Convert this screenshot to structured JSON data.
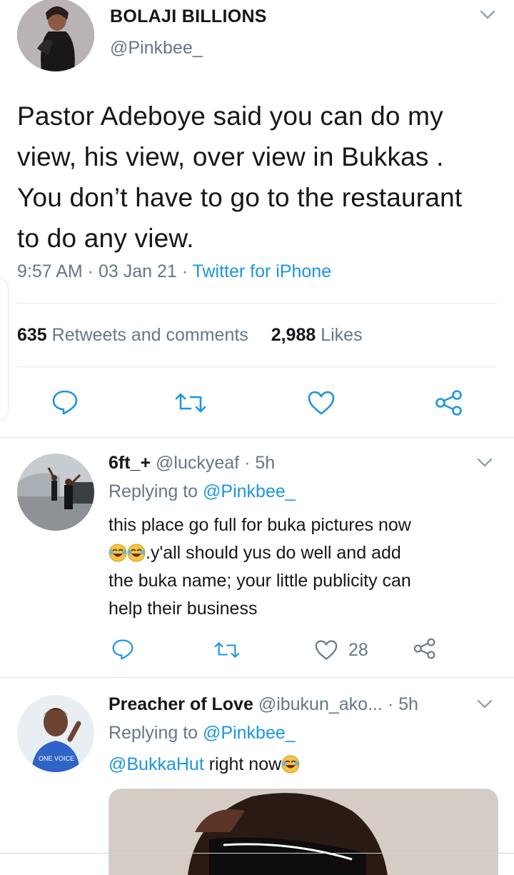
{
  "main_tweet": {
    "author_name": "BOLAJI BILLIONS",
    "author_handle": "@Pinkbee_",
    "text": "Pastor Adeboye said you can do my view, his view, over view in Bukkas . You don’t have to go to the restaurant to do any view.",
    "time": "9:57 AM",
    "date": "03 Jan 21",
    "sep": "·",
    "source": "Twitter for iPhone",
    "retweets_count": "635",
    "retweets_label": "Retweets and comments",
    "likes_count": "2,988",
    "likes_label": "Likes"
  },
  "replies": [
    {
      "name": "6ft_+",
      "handle": "@luckyeaf",
      "time": "· 5h",
      "replying_prefix": "Replying to",
      "replying_to": "@Pinkbee_",
      "text_line1": "this place go full for buka pictures now",
      "text_line2": ".y'all should yus do well and add",
      "text_line3": "the buka name; your little publicity  can",
      "text_line4": "help their business",
      "like_count": "28"
    },
    {
      "name": "Preacher of Love",
      "handle": "@ibukun_ako...",
      "time": "· 5h",
      "replying_prefix": "Replying to",
      "replying_to": "@Pinkbee_",
      "mention": "@BukkaHut",
      "text": " right now"
    }
  ],
  "colors": {
    "link": "#1b95e0",
    "muted": "#657786",
    "text": "#14171a",
    "divider": "#e1e8ed"
  },
  "icons": [
    "chevron-down-icon",
    "reply-icon",
    "retweet-icon",
    "like-icon",
    "share-icon",
    "laughing-emoji-icon"
  ]
}
